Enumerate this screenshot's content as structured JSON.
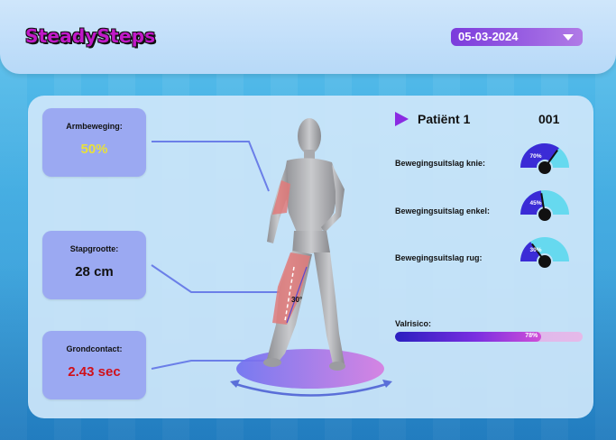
{
  "app": {
    "logo": "SteadySteps"
  },
  "header": {
    "date": "05-03-2024"
  },
  "cards": {
    "arm": {
      "label": "Armbeweging:",
      "value": "50%",
      "color": "#e8e13a"
    },
    "step": {
      "label": "Stapgrootte:",
      "value": "28 cm",
      "color": "#111111"
    },
    "ground": {
      "label": "Grondcontact:",
      "value": "2.43 sec",
      "color": "#d0101a"
    }
  },
  "figure": {
    "knee_angle": "30°"
  },
  "patient": {
    "name": "Patiënt 1",
    "id": "001"
  },
  "metrics": [
    {
      "label": "Bewegingsuitslag knie:",
      "percent_label": "70%",
      "value": 0.7
    },
    {
      "label": "Bewegingsuitslag enkel:",
      "percent_label": "45%",
      "value": 0.45
    },
    {
      "label": "Bewegingsuitslag rug:",
      "percent_label": "30%",
      "value": 0.3
    }
  ],
  "fall_risk": {
    "label": "Valrisico:",
    "percent_label": "78%",
    "value": 0.78
  },
  "colors": {
    "accent": "#8a2be2",
    "card": "#9ba9f2",
    "gauge_fill": "#3b2bd6",
    "gauge_track": "#66d9ef"
  }
}
